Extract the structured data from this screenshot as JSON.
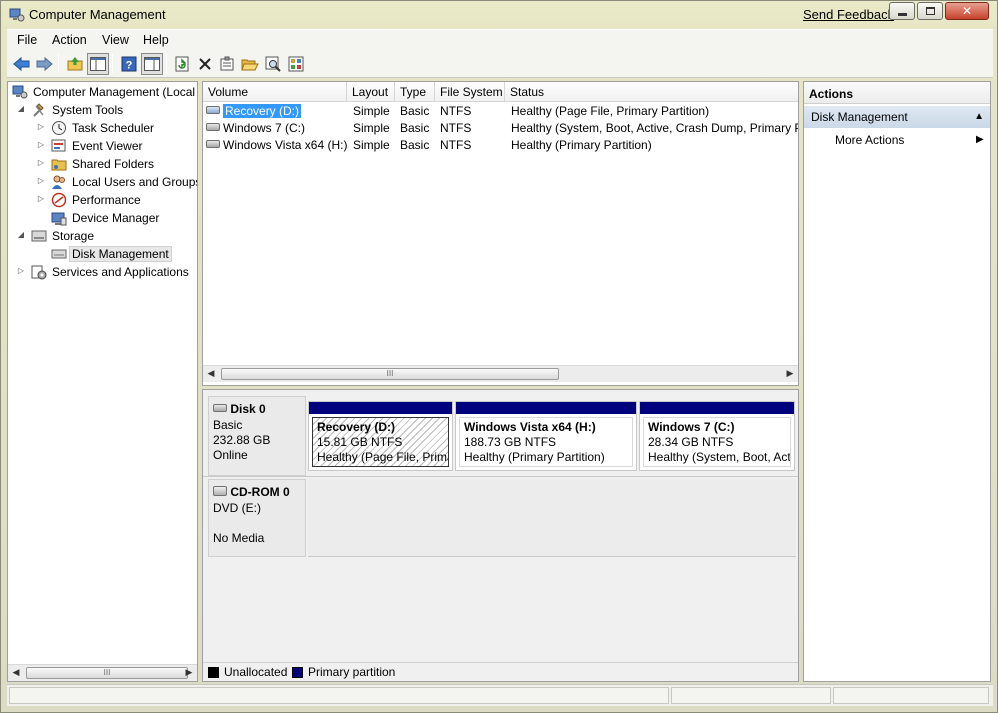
{
  "window": {
    "title": "Computer Management",
    "send_feedback": "Send Feedback"
  },
  "menu": {
    "items": [
      "File",
      "Action",
      "View",
      "Help"
    ]
  },
  "toolbar": {
    "icons": [
      "back-arrow-icon",
      "forward-arrow-icon",
      "up-folder-icon",
      "show-hide-tree-icon",
      "help-icon",
      "show-hide-action-icon",
      "refresh-icon",
      "delete-icon",
      "properties-icon",
      "open-folder-icon",
      "search-icon",
      "settings-icon"
    ]
  },
  "tree": {
    "root": "Computer Management (Local",
    "system_tools": "System Tools",
    "task_scheduler": "Task Scheduler",
    "event_viewer": "Event Viewer",
    "shared_folders": "Shared Folders",
    "local_users": "Local Users and Groups",
    "performance": "Performance",
    "device_manager": "Device Manager",
    "storage": "Storage",
    "disk_management": "Disk Management",
    "services": "Services and Applications",
    "scroll_thumb": "III"
  },
  "volume_list": {
    "columns": [
      "Volume",
      "Layout",
      "Type",
      "File System",
      "Status"
    ],
    "rows": [
      {
        "volume": "Recovery (D:)",
        "layout": "Simple",
        "type": "Basic",
        "fs": "NTFS",
        "status": "Healthy (Page File, Primary Partition)"
      },
      {
        "volume": "Windows 7 (C:)",
        "layout": "Simple",
        "type": "Basic",
        "fs": "NTFS",
        "status": "Healthy (System, Boot, Active, Crash Dump, Primary P"
      },
      {
        "volume": "Windows Vista x64 (H:)",
        "layout": "Simple",
        "type": "Basic",
        "fs": "NTFS",
        "status": "Healthy (Primary Partition)"
      }
    ],
    "scroll_thumb": "III"
  },
  "disks": {
    "disk0": {
      "title": "Disk 0",
      "type": "Basic",
      "size": "232.88 GB",
      "state": "Online",
      "partitions": [
        {
          "name": "Recovery  (D:)",
          "size": "15.81 GB NTFS",
          "status": "Healthy (Page File, Prima"
        },
        {
          "name": "Windows Vista x64  (H:)",
          "size": "188.73 GB NTFS",
          "status": "Healthy (Primary Partition)"
        },
        {
          "name": "Windows 7  (C:)",
          "size": "28.34 GB NTFS",
          "status": "Healthy (System, Boot, Act"
        }
      ]
    },
    "cdrom0": {
      "title": "CD-ROM 0",
      "type": "DVD (E:)",
      "state": "No Media"
    }
  },
  "legend": {
    "unallocated": "Unallocated",
    "primary": "Primary partition",
    "unallocated_color": "#000000",
    "primary_color": "#00007f"
  },
  "actions": {
    "header": "Actions",
    "section": "Disk Management",
    "more_actions": "More Actions"
  }
}
